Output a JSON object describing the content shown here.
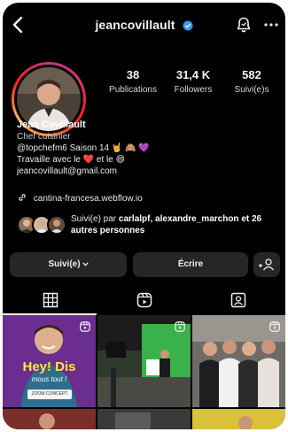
{
  "header": {
    "username": "jeancovillault",
    "verified": true
  },
  "profile": {
    "stats": [
      {
        "value": "38",
        "label": "Publications"
      },
      {
        "value": "31,4 K",
        "label": "Followers"
      },
      {
        "value": "582",
        "label": "Suivi(e)s"
      }
    ],
    "name": "Jean Covillault",
    "category": "Chef cuisinier",
    "bio_line1_text": "@topchefm6 Saison 14",
    "bio_line1_emojis": "🤘 🙈 💜",
    "bio_line2_text": "Travaille avec le",
    "bio_line2_emoji1": "❤️",
    "bio_line2_mid": "et le",
    "bio_line2_emoji2": "😄",
    "email": "jeancovillault@gmail.com",
    "link": "cantina-francesa.webflow.io"
  },
  "followed_by": {
    "prefix": "Suivi(e) par",
    "names": "carlalpf, alexandre_marchon",
    "suffix": "et 26 autres personnes"
  },
  "buttons": {
    "following": "Suivi(e)",
    "message": "Écrire"
  },
  "grid": {
    "post1_title": "Hey! Dis",
    "post1_subtitle": "mous tout !",
    "post1_badge": "ZOOM CONCEPT"
  },
  "colors": {
    "background": "#000000",
    "verified_blue": "#3897f0",
    "button_bg": "#262626",
    "post1_bg": "#6b2d8f",
    "post1_text": "#e8f04a"
  },
  "icons": [
    "back-arrow-icon",
    "verified-badge-icon",
    "notification-bell-icon",
    "more-options-icon",
    "link-icon",
    "add-person-icon",
    "grid-tab-icon",
    "reels-tab-icon",
    "tagged-tab-icon",
    "reel-icon"
  ]
}
